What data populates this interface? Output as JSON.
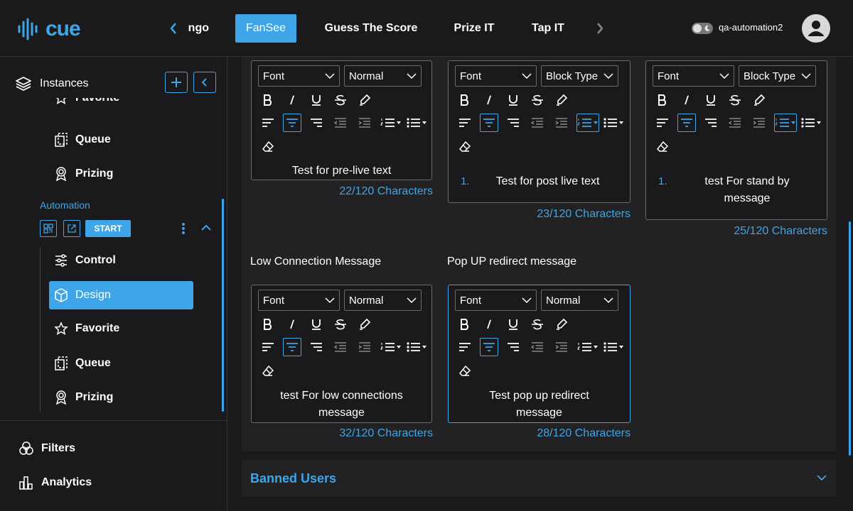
{
  "app": {
    "logo_text": "cue",
    "username": "qa-automation2"
  },
  "tabs": [
    {
      "label": "ngo"
    },
    {
      "label": "FanSee"
    },
    {
      "label": "Guess The Score"
    },
    {
      "label": "Prize IT"
    },
    {
      "label": "Tap IT"
    }
  ],
  "sidebar": {
    "title": "Instances",
    "items_top": [
      {
        "label": "Favorite"
      },
      {
        "label": "Queue"
      },
      {
        "label": "Prizing"
      }
    ],
    "group_label": "Automation",
    "start_label": "START",
    "items_group": [
      {
        "label": "Control"
      },
      {
        "label": "Design"
      },
      {
        "label": "Favorite"
      },
      {
        "label": "Queue"
      },
      {
        "label": "Prizing"
      }
    ],
    "filters": "Filters",
    "analytics": "Analytics"
  },
  "editors": [
    {
      "font": "Font",
      "style": "Normal",
      "text": "Test for pre-live text",
      "counter": "22/120 Characters"
    },
    {
      "font": "Font",
      "style": "Block Type",
      "list_num": "1.",
      "text": "Test for post live text",
      "counter": "23/120 Characters"
    },
    {
      "font": "Font",
      "style": "Block Type",
      "list_num": "1.",
      "text": "test For stand by message",
      "counter": "25/120 Characters"
    },
    {
      "label": "Low Connection Message",
      "font": "Font",
      "style": "Normal",
      "text": "test For low connections message",
      "counter": "32/120 Characters"
    },
    {
      "label": "Pop UP redirect message",
      "font": "Font",
      "style": "Normal",
      "text": "Test pop up redirect message",
      "counter": "28/120 Characters"
    }
  ],
  "banned_users": "Banned Users",
  "colors": {
    "accent": "#3ea6e8",
    "bg": "#1a1a1c",
    "panel": "#222224"
  }
}
